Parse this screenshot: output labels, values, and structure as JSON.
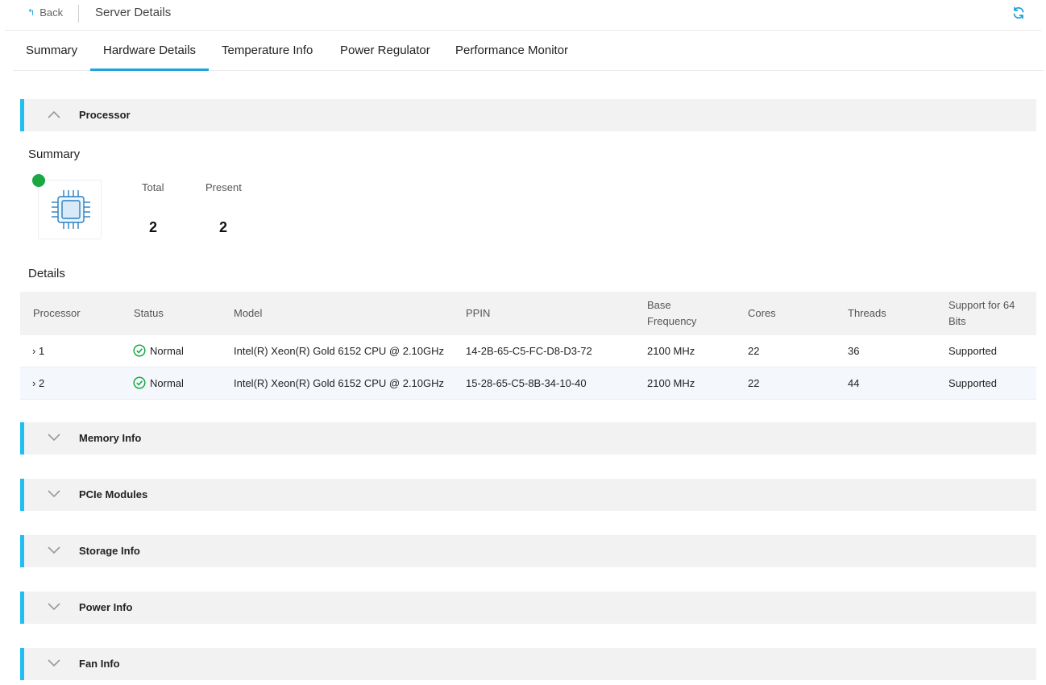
{
  "topbar": {
    "back_label": "Back",
    "title": "Server Details"
  },
  "tabs": [
    {
      "label": "Summary"
    },
    {
      "label": "Hardware Details",
      "active": true
    },
    {
      "label": "Temperature Info"
    },
    {
      "label": "Power Regulator"
    },
    {
      "label": "Performance Monitor"
    }
  ],
  "processor": {
    "section_label": "Processor",
    "summary_heading": "Summary",
    "total_label": "Total",
    "total_value": "2",
    "present_label": "Present",
    "present_value": "2",
    "details_heading": "Details",
    "columns": [
      "Processor",
      "Status",
      "Model",
      "PPIN",
      "Base Frequency",
      "Cores",
      "Threads",
      "Support for 64 Bits"
    ],
    "rows": [
      {
        "processor": "1",
        "status": "Normal",
        "model": "Intel(R) Xeon(R) Gold 6152 CPU @ 2.10GHz",
        "ppin": "14-2B-65-C5-FC-D8-D3-72",
        "base_frequency": "2100 MHz",
        "cores": "22",
        "threads": "36",
        "support64": "Supported"
      },
      {
        "processor": "2",
        "status": "Normal",
        "model": "Intel(R) Xeon(R) Gold 6152 CPU @ 2.10GHz",
        "ppin": "15-28-65-C5-8B-34-10-40",
        "base_frequency": "2100 MHz",
        "cores": "22",
        "threads": "44",
        "support64": "Supported"
      }
    ]
  },
  "sections": [
    {
      "label": "Memory Info"
    },
    {
      "label": "PCIe Modules"
    },
    {
      "label": "Storage Info"
    },
    {
      "label": "Power Info"
    },
    {
      "label": "Fan Info"
    }
  ],
  "colors": {
    "accent": "#1fa3dc",
    "section_bar": "#1fbff0",
    "status_ok": "#1aa843"
  }
}
